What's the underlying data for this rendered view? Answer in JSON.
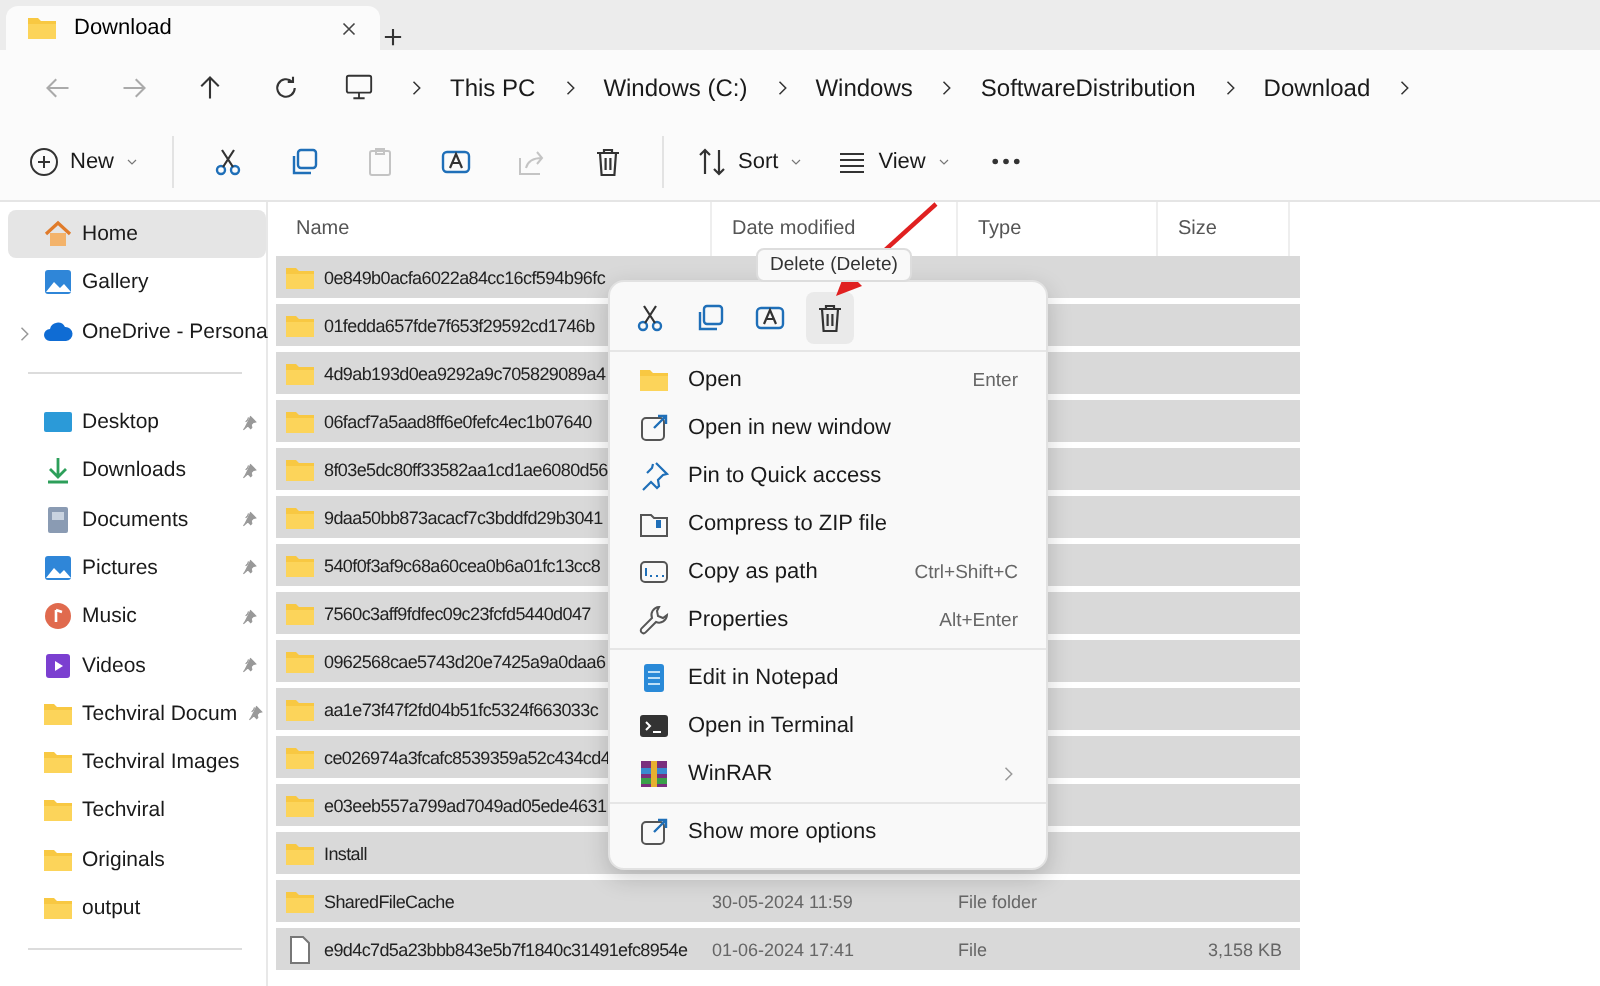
{
  "tabs": [
    {
      "title": "Download",
      "selected": true
    }
  ],
  "nav": {
    "back_disabled": true,
    "forward_disabled": true,
    "breadcrumbs": [
      "This PC",
      "Windows (C:)",
      "Windows",
      "SoftwareDistribution",
      "Download"
    ]
  },
  "toolbar": [
    {
      "kind": "new",
      "label": "New",
      "disabled": false
    },
    {
      "kind": "sep"
    },
    {
      "kind": "cut",
      "disabled": false
    },
    {
      "kind": "copy",
      "disabled": false
    },
    {
      "kind": "paste",
      "disabled": true
    },
    {
      "kind": "rename",
      "disabled": false
    },
    {
      "kind": "share",
      "disabled": true
    },
    {
      "kind": "delete",
      "disabled": false
    },
    {
      "kind": "sep"
    },
    {
      "kind": "sort",
      "label": "Sort",
      "disabled": false
    },
    {
      "kind": "view",
      "label": "View",
      "disabled": false
    },
    {
      "kind": "more",
      "disabled": false
    }
  ],
  "sidebar": {
    "sections": [
      [
        {
          "label": "Home",
          "selected": true,
          "pinned": false,
          "expandable": false
        },
        {
          "label": "Gallery",
          "selected": false,
          "pinned": false,
          "expandable": false
        },
        {
          "label": "OneDrive - Persona",
          "selected": false,
          "pinned": false,
          "expandable": true
        }
      ],
      [
        {
          "label": "Desktop",
          "selected": false,
          "pinned": true,
          "expandable": false
        },
        {
          "label": "Downloads",
          "selected": false,
          "pinned": true,
          "expandable": false
        },
        {
          "label": "Documents",
          "selected": false,
          "pinned": true,
          "expandable": false
        },
        {
          "label": "Pictures",
          "selected": false,
          "pinned": true,
          "expandable": false
        },
        {
          "label": "Music",
          "selected": false,
          "pinned": true,
          "expandable": false
        },
        {
          "label": "Videos",
          "selected": false,
          "pinned": true,
          "expandable": false
        },
        {
          "label": "Techviral Docum",
          "selected": false,
          "pinned": true,
          "expandable": false
        },
        {
          "label": "Techviral Images",
          "selected": false,
          "pinned": false,
          "expandable": false
        },
        {
          "label": "Techviral",
          "selected": false,
          "pinned": false,
          "expandable": false
        },
        {
          "label": "Originals",
          "selected": false,
          "pinned": false,
          "expandable": false
        },
        {
          "label": "output",
          "selected": false,
          "pinned": false,
          "expandable": false
        }
      ]
    ]
  },
  "table": {
    "columns": [
      "Name",
      "Date modified",
      "Type",
      "Size"
    ],
    "rows": [
      {
        "kind": "folder",
        "name": "0e849b0acfa6022a84cc16cf594b96fc",
        "selected": true
      },
      {
        "kind": "folder",
        "name": "01fedda657fde7f653f29592cd1746b",
        "selected": true
      },
      {
        "kind": "folder",
        "name": "4d9ab193d0ea9292a9c705829089a4",
        "selected": true
      },
      {
        "kind": "folder",
        "name": "06facf7a5aad8ff6e0fefc4ec1b07640",
        "selected": true
      },
      {
        "kind": "folder",
        "name": "8f03e5dc80ff33582aa1cd1ae6080d56",
        "selected": true
      },
      {
        "kind": "folder",
        "name": "9daa50bb873acacf7c3bddfd29b3041",
        "selected": true
      },
      {
        "kind": "folder",
        "name": "540f0f3af9c68a60cea0b6a01fc13cc8",
        "selected": true
      },
      {
        "kind": "folder",
        "name": "7560c3aff9fdfec09c23fcfd5440d047",
        "selected": true
      },
      {
        "kind": "folder",
        "name": "0962568cae5743d20e7425a9a0daa6",
        "selected": true
      },
      {
        "kind": "folder",
        "name": "aa1e73f47f2fd04b51fc5324f663033c",
        "selected": true
      },
      {
        "kind": "folder",
        "name": "ce026974a3fcafc8539359a52c434cd4",
        "selected": true
      },
      {
        "kind": "folder",
        "name": "e03eeb557a799ad7049ad05ede4631",
        "selected": true
      },
      {
        "kind": "folder",
        "name": "Install",
        "selected": true
      },
      {
        "kind": "folder",
        "name": "SharedFileCache",
        "date": "30-05-2024 11:59",
        "type": "File folder",
        "selected": true
      },
      {
        "kind": "file",
        "name": "e9d4c7d5a23bbb843e5b7f1840c31491efc8954e",
        "date": "01-06-2024 17:41",
        "type": "File",
        "size": "3,158 KB",
        "selected": true
      }
    ]
  },
  "context_menu": {
    "quick_actions": [
      {
        "kind": "cut",
        "hovered": false
      },
      {
        "kind": "copy",
        "hovered": false
      },
      {
        "kind": "rename",
        "hovered": false
      },
      {
        "kind": "delete",
        "hovered": true
      }
    ],
    "tooltip": "Delete (Delete)",
    "groups": [
      [
        {
          "label": "Open",
          "shortcut": "Enter",
          "submenu": false
        },
        {
          "label": "Open in new window",
          "submenu": false
        },
        {
          "label": "Pin to Quick access",
          "submenu": false
        },
        {
          "label": "Compress to ZIP file",
          "submenu": false
        },
        {
          "label": "Copy as path",
          "shortcut": "Ctrl+Shift+C",
          "submenu": false
        },
        {
          "label": "Properties",
          "shortcut": "Alt+Enter",
          "submenu": false
        }
      ],
      [
        {
          "label": "Edit in Notepad",
          "submenu": false
        },
        {
          "label": "Open in Terminal",
          "submenu": false
        },
        {
          "label": "WinRAR",
          "submenu": true
        }
      ],
      [
        {
          "label": "Show more options",
          "submenu": false
        }
      ]
    ]
  }
}
